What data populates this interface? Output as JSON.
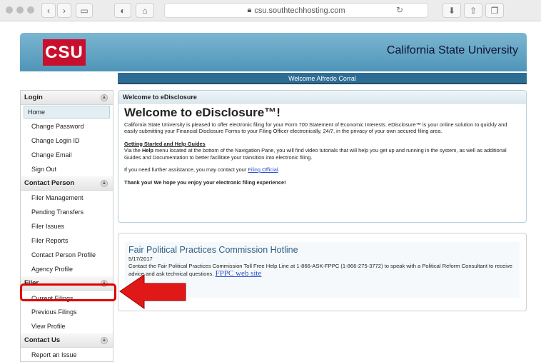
{
  "browser": {
    "url": "csu.southtechhosting.com",
    "nav_back": "‹",
    "nav_forward": "›"
  },
  "header": {
    "logo": "CSU",
    "title": "California State University",
    "welcome": "Welcome Alfredo Corral"
  },
  "sidebar": {
    "login": {
      "label": "Login",
      "items": [
        "Home",
        "Change Password",
        "Change Login ID",
        "Change Email",
        "Sign Out"
      ]
    },
    "contact_person": {
      "label": "Contact Person",
      "items": [
        "Filer Management",
        "Pending Transfers",
        "Filer Issues",
        "Filer Reports",
        "Contact Person Profile",
        "Agency Profile"
      ]
    },
    "filer": {
      "label": "Filer",
      "items": [
        "Current Filings",
        "Previous Filings",
        "View Profile"
      ]
    },
    "contact_us": {
      "label": "Contact Us",
      "items": [
        "Report an Issue"
      ]
    }
  },
  "welcome_panel": {
    "title": "Welcome to eDisclosure",
    "heading": "Welcome to eDisclosure™!",
    "intro": "California State University is pleased to offer electronic filing for your Form 700 Statement of Economic Interests. eDisclosure™ is your online solution to quickly and easily submitting your Financial Disclosure Forms to your Filing Officer electronically, 24/7, in the privacy of your own secured filing area.",
    "guides_heading": "Getting Started and Help Guides",
    "guides_pre": "Via the ",
    "guides_help": "Help",
    "guides_post": " menu located at the bottom of the Navigation Pane, you will find video tutorials that will help you get up and running in the system, as well as additional Guides and Documentation to better facilitate your transition into electronic filing.",
    "assist_pre": "If you need further assistance, you may contact your ",
    "assist_link": "Filing Official",
    "assist_post": ".",
    "thanks": "Thank you! We hope you enjoy your electronic filing experience!"
  },
  "news": {
    "title": "Fair Political Practices Commission Hotline",
    "date": "5/17/2017",
    "body": "Contact the Fair Political Practices Commission Toll Free Help Line at 1-866-ASK-FPPC (1-866-275-3772) to speak with a Political Reform Consultant to receive advice and ask technical questions. ",
    "link": "FPPC web site"
  },
  "colors": {
    "highlight": "#e00000",
    "header_blue": "#4f95b8"
  }
}
